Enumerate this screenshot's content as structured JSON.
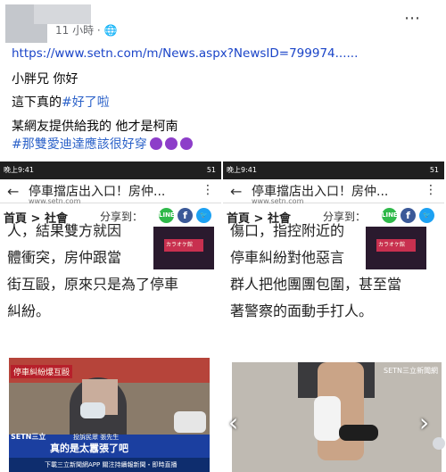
{
  "post": {
    "time": "11 小時 ·",
    "link": "https://www.setn.com/m/News.aspx?NewsID=799974......",
    "line1": "小胖兄 你好",
    "line2_prefix": "這下真的",
    "line2_tag": "#好了啦",
    "line3": "某網友提供給我的 他才是柯南",
    "line4_tag": "#那雙愛迪達應該很好穿",
    "more_icon": "⋯"
  },
  "shots": [
    {
      "status_time": "晚上9:41",
      "battery": "51",
      "title": "停車擋店出入口！房仲...",
      "url": "www.setn.com",
      "crumb": "首頁 > 社會",
      "share_label": "分享到：",
      "article_lines": [
        "人，結果雙方就因",
        "體衝突，房仲跟當",
        "街互毆，原來只是為了停車",
        "糾紛。"
      ],
      "video": {
        "banner": "停車糾紛爆互毆",
        "logo": "SETN三立",
        "speaker": "投訴民眾 張先生",
        "caption": "真的是太囂張了吧",
        "ticker": "下載三立新聞網APP 關注持續報新聞・即時直播"
      },
      "ad_text": "カラオケ館"
    },
    {
      "status_time": "晚上9:41",
      "battery": "51",
      "title": "停車擋店出入口！房仲...",
      "url": "www.setn.com",
      "crumb": "首頁 > 社會",
      "share_label": "分享到：",
      "article_lines": [
        "傷口，指控附近的",
        "停車糾紛對他惡言",
        "群人把他團團包圍，甚至當",
        "著警察的面動手打人。"
      ],
      "photo_wm": "SETN三立新聞網",
      "ad_text": "カラオケ館"
    }
  ]
}
